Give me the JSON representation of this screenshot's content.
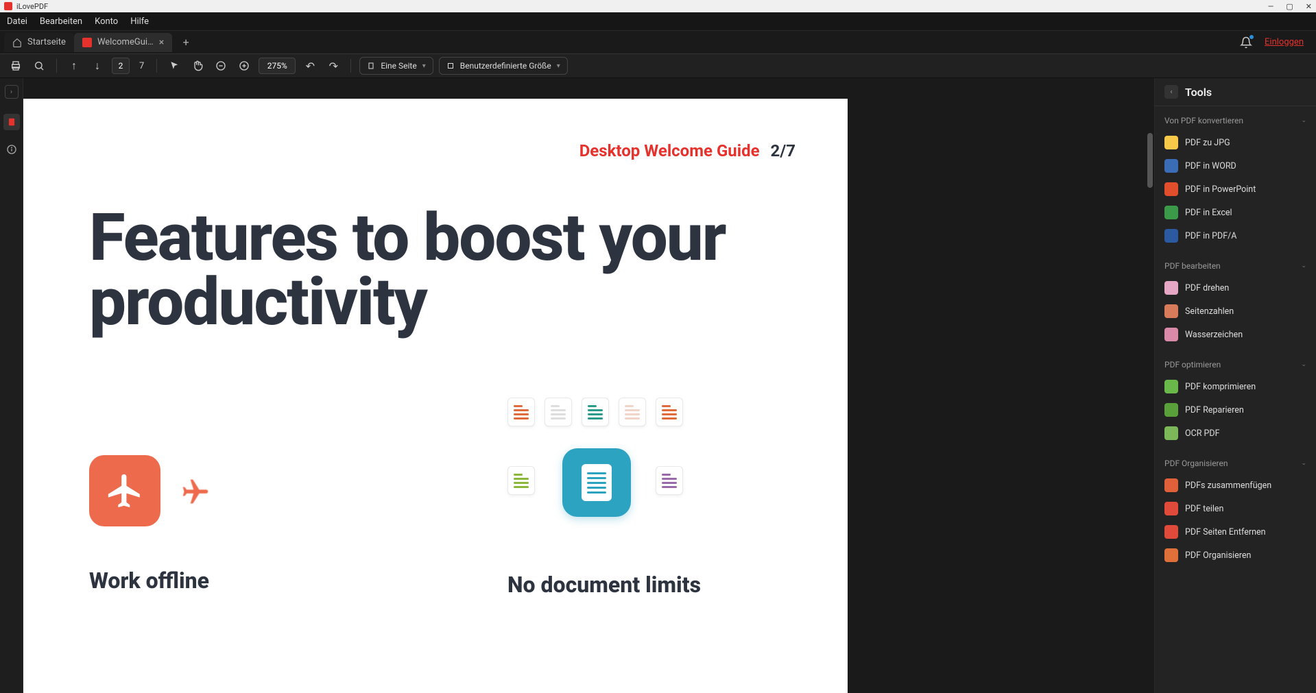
{
  "app_name": "iLovePDF",
  "menubar": [
    "Datei",
    "Bearbeiten",
    "Konto",
    "Hilfe"
  ],
  "tabs": {
    "home": "Startseite",
    "active": "WelcomeGui…"
  },
  "login_label": "Einloggen",
  "toolbar": {
    "current_page": "2",
    "total_pages": "7",
    "zoom": "275%",
    "layout_dropdown": "Eine Seite",
    "size_dropdown": "Benutzerdefinierte Größe"
  },
  "document": {
    "guide_title": "Desktop Welcome Guide",
    "page_indicator": "2/7",
    "headline_line1": "Features to boost your",
    "headline_line2": "productivity",
    "feature1_title": "Work offline",
    "feature2_title": "No document limits"
  },
  "panel": {
    "title": "Tools",
    "sections": [
      {
        "title": "Von PDF konvertieren",
        "items": [
          {
            "label": "PDF zu JPG",
            "color": "#f7c948"
          },
          {
            "label": "PDF in WORD",
            "color": "#3a6db5"
          },
          {
            "label": "PDF in PowerPoint",
            "color": "#e04e2c"
          },
          {
            "label": "PDF in Excel",
            "color": "#3a9a4a"
          },
          {
            "label": "PDF in PDF/A",
            "color": "#2b5aa0"
          }
        ]
      },
      {
        "title": "PDF bearbeiten",
        "items": [
          {
            "label": "PDF drehen",
            "color": "#e6a7c5"
          },
          {
            "label": "Seitenzahlen",
            "color": "#d87b5a"
          },
          {
            "label": "Wasserzeichen",
            "color": "#d88aa8"
          }
        ]
      },
      {
        "title": "PDF optimieren",
        "items": [
          {
            "label": "PDF komprimieren",
            "color": "#6bb84a"
          },
          {
            "label": "PDF Reparieren",
            "color": "#5aa03a"
          },
          {
            "label": "OCR PDF",
            "color": "#7cb85a"
          }
        ]
      },
      {
        "title": "PDF Organisieren",
        "items": [
          {
            "label": "PDFs zusammenfügen",
            "color": "#e0603a"
          },
          {
            "label": "PDF teilen",
            "color": "#e04a3a"
          },
          {
            "label": "PDF Seiten Entfernen",
            "color": "#e04a3a"
          },
          {
            "label": "PDF Organisieren",
            "color": "#e0703a"
          }
        ]
      }
    ]
  }
}
